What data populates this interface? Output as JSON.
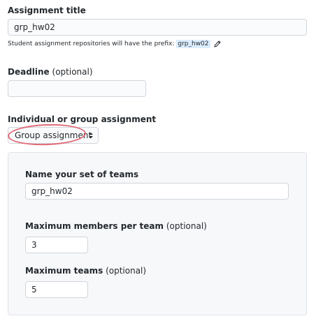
{
  "assignment_title": {
    "label": "Assignment title",
    "value": "grp_hw02",
    "note_text": "Student assignment repositories will have the prefix:",
    "note_prefix": "grp_hw02",
    "edit_icon": "pencil-icon"
  },
  "deadline": {
    "label": "Deadline",
    "optional": " (optional)",
    "value": ""
  },
  "assignment_type": {
    "label": "Individual or group assignment",
    "selected": "Group assignment",
    "caret_icon": "select-caret-icon",
    "highlight_color": "#e06a77"
  },
  "group_settings": {
    "team_set": {
      "label": "Name your set of teams",
      "value": "grp_hw02"
    },
    "max_members": {
      "label": "Maximum members per team",
      "optional": " (optional)",
      "value": "3"
    },
    "max_teams": {
      "label": "Maximum teams",
      "optional": " (optional)",
      "value": "5"
    }
  }
}
